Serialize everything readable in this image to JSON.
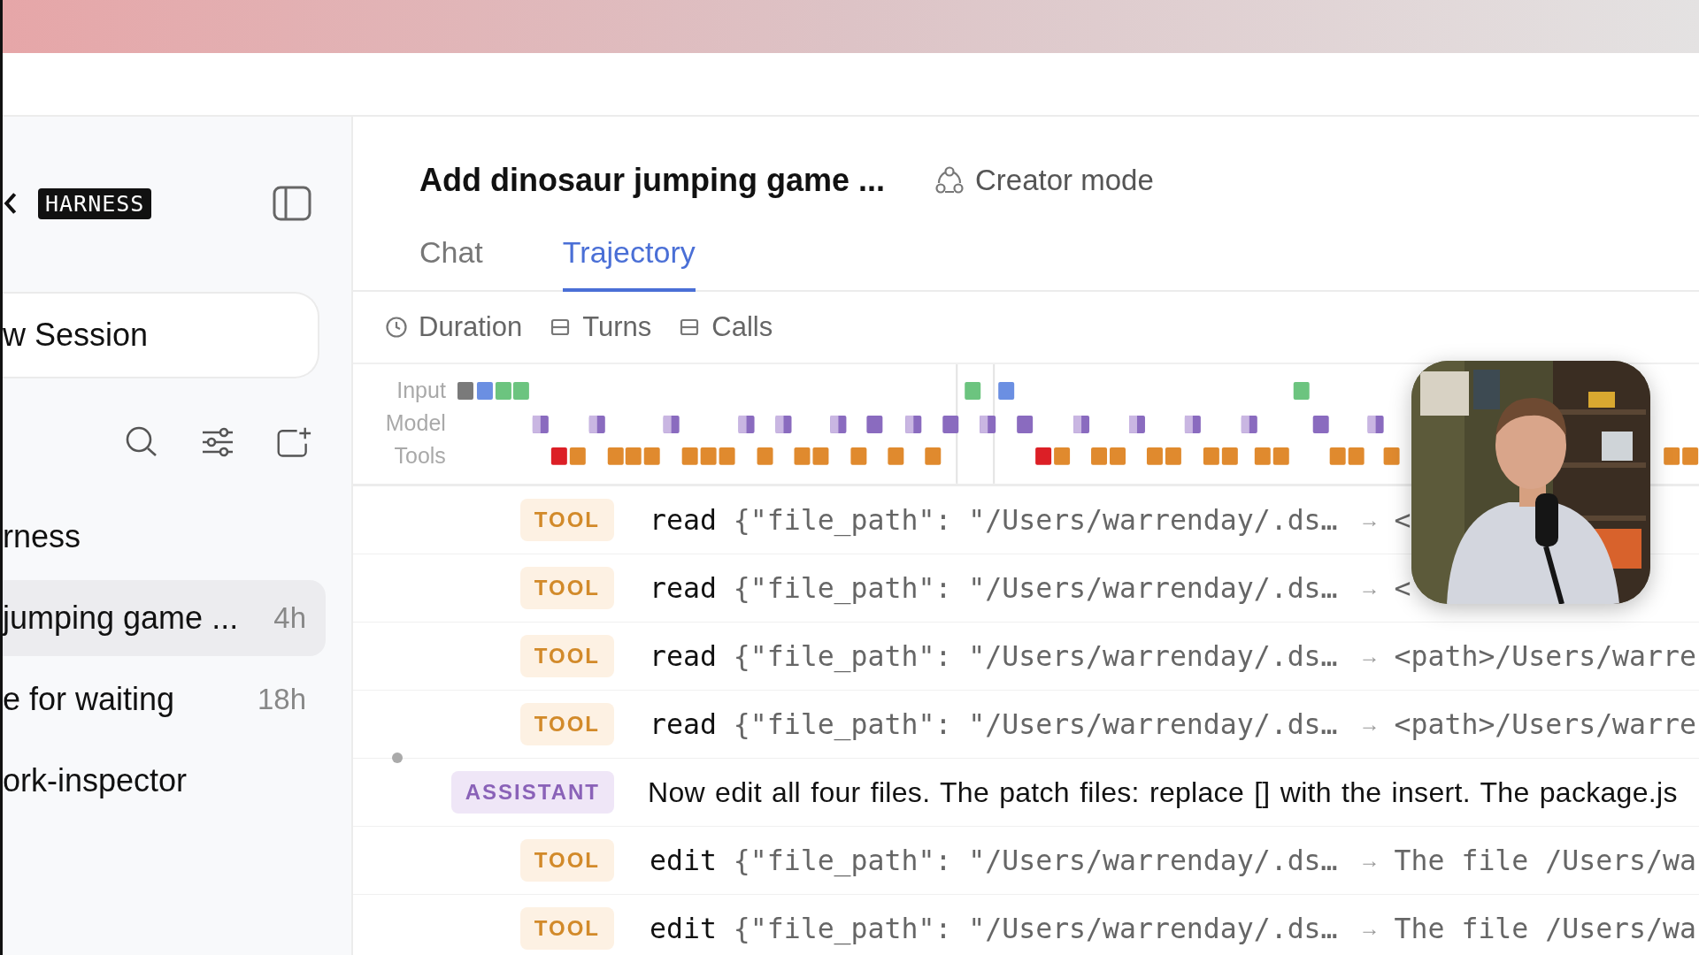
{
  "sidebar": {
    "brand": "HARNESS",
    "new_session": "w Session",
    "items": [
      {
        "title": "rness",
        "selected": false
      },
      {
        "title": "jumping game ...",
        "time": "4h",
        "selected": true
      },
      {
        "title": "e for waiting",
        "time": "18h",
        "selected": false
      },
      {
        "title": "ork-inspector",
        "selected": false
      }
    ]
  },
  "header": {
    "title": "Add dinosaur jumping game ...",
    "mode": "Creator mode"
  },
  "tabs": [
    {
      "label": "Chat",
      "selected": false
    },
    {
      "label": "Trajectory",
      "selected": true
    }
  ],
  "filters": [
    {
      "label": "Duration",
      "kind": "clock"
    },
    {
      "label": "Turns",
      "kind": "list"
    },
    {
      "label": "Calls",
      "kind": "list"
    }
  ],
  "timeline": {
    "lanes": [
      "Input",
      "Model",
      "Tools"
    ]
  },
  "events": [
    {
      "kind": "tool",
      "role": "TOOL",
      "action": "read",
      "args": "{\"file_path\": \"/Users/warrenday/.ds…",
      "arrow": "→",
      "result": "<"
    },
    {
      "kind": "tool",
      "role": "TOOL",
      "action": "read",
      "args": "{\"file_path\": \"/Users/warrenday/.ds…",
      "arrow": "→",
      "result": "<"
    },
    {
      "kind": "tool",
      "role": "TOOL",
      "action": "read",
      "args": "{\"file_path\": \"/Users/warrenday/.ds…",
      "arrow": "→",
      "result": "<path>/Users/warre"
    },
    {
      "kind": "tool",
      "role": "TOOL",
      "action": "read",
      "args": "{\"file_path\": \"/Users/warrenday/.ds…",
      "arrow": "→",
      "result": "<path>/Users/warre"
    },
    {
      "kind": "assistant",
      "role": "ASSISTANT",
      "text": "Now edit all four files. The patch files: replace [] with the insert. The package.js"
    },
    {
      "kind": "tool",
      "role": "TOOL",
      "action": "edit",
      "args": "{\"file_path\": \"/Users/warrenday/.ds…",
      "arrow": "→",
      "result": "The file /Users/wa"
    },
    {
      "kind": "tool",
      "role": "TOOL",
      "action": "edit",
      "args": "{\"file_path\": \"/Users/warrenday/.ds…",
      "arrow": "→",
      "result": "The file /Users/wa"
    }
  ]
}
